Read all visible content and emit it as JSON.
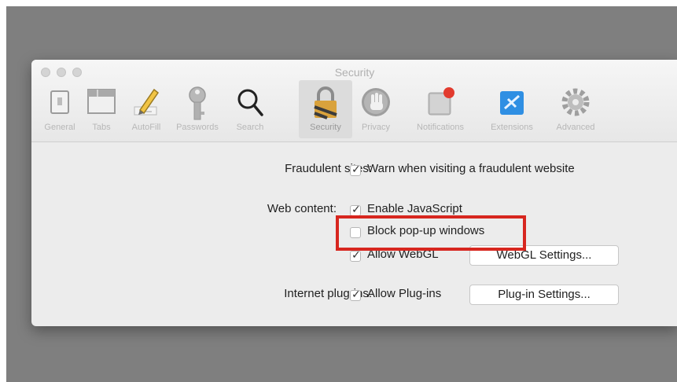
{
  "window": {
    "title": "Security"
  },
  "toolbar": {
    "items": [
      {
        "label": "General",
        "icon": "general-icon"
      },
      {
        "label": "Tabs",
        "icon": "tabs-icon"
      },
      {
        "label": "AutoFill",
        "icon": "autofill-pencil-icon"
      },
      {
        "label": "Passwords",
        "icon": "key-icon"
      },
      {
        "label": "Search",
        "icon": "magnifier-icon"
      },
      {
        "label": "Security",
        "icon": "padlock-icon",
        "selected": true
      },
      {
        "label": "Privacy",
        "icon": "hand-icon"
      },
      {
        "label": "Notifications",
        "icon": "notification-icon"
      },
      {
        "label": "Extensions",
        "icon": "puzzle-icon"
      },
      {
        "label": "Advanced",
        "icon": "gear-icon"
      }
    ]
  },
  "security": {
    "fraudulent": {
      "label": "Fraudulent sites:",
      "option": "Warn when visiting a fraudulent website",
      "checked": true
    },
    "web_content": {
      "label": "Web content:",
      "options": [
        {
          "label": "Enable JavaScript",
          "checked": true
        },
        {
          "label": "Block pop-up windows",
          "checked": false
        },
        {
          "label": "Allow WebGL",
          "checked": true
        }
      ],
      "webgl_button": "WebGL Settings..."
    },
    "plugins": {
      "label": "Internet plug-ins:",
      "option": "Allow Plug-ins",
      "checked": true,
      "button": "Plug-in Settings..."
    }
  },
  "colors": {
    "highlight": "#d7261f",
    "background": "#7f7f7f",
    "window": "#ececec"
  }
}
